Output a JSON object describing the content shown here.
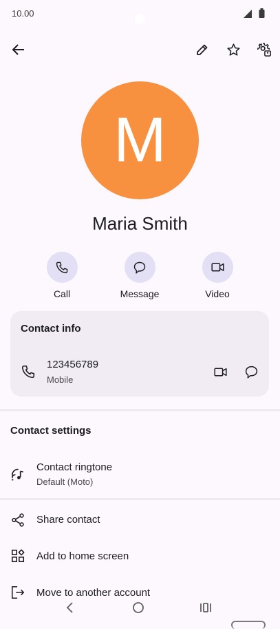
{
  "status_bar": {
    "time": "10.00"
  },
  "header": {
    "icons": [
      "back-arrow-icon",
      "edit-icon",
      "star-icon",
      "settings-icon"
    ]
  },
  "contact": {
    "initial": "M",
    "avatar_color": "#f7913f",
    "name": "Maria Smith"
  },
  "actions": [
    {
      "label": "Call",
      "icon": "phone-icon"
    },
    {
      "label": "Message",
      "icon": "message-icon"
    },
    {
      "label": "Video",
      "icon": "video-icon"
    }
  ],
  "contact_info": {
    "title": "Contact info",
    "number": "123456789",
    "number_type": "Mobile"
  },
  "contact_settings": {
    "title": "Contact settings",
    "ringtone_label": "Contact ringtone",
    "ringtone_value": "Default (Moto)"
  },
  "menu": [
    {
      "label": "Share contact",
      "icon": "share-icon"
    },
    {
      "label": "Add to home screen",
      "icon": "add-to-home-icon"
    },
    {
      "label": "Move to another account",
      "icon": "move-account-icon"
    }
  ],
  "colors": {
    "accent_circle": "#e3e0f6",
    "card_bg": "#f1ecf4",
    "background": "#fdf8fd"
  }
}
